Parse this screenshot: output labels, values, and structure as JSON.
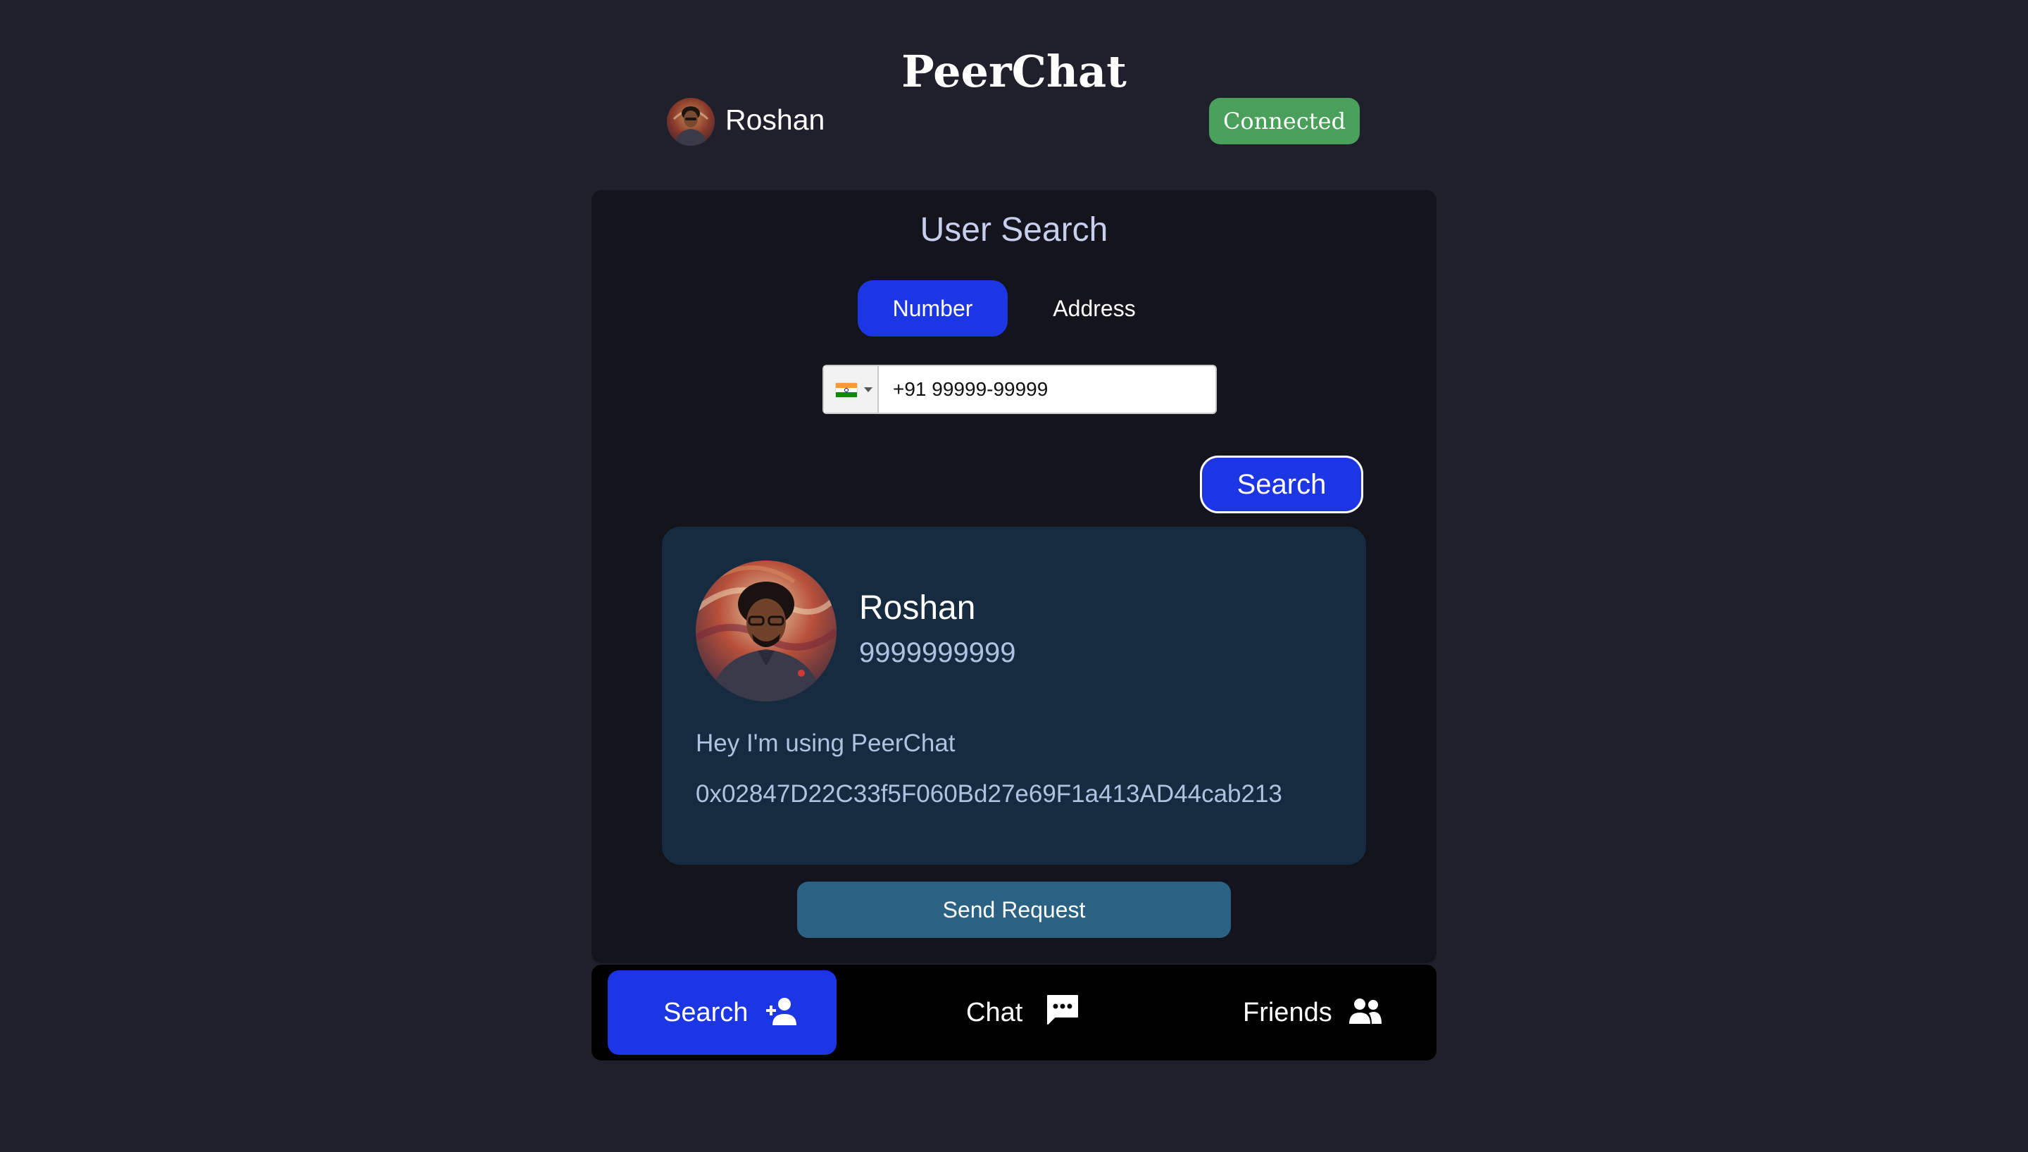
{
  "app": {
    "title": "PeerChat"
  },
  "header": {
    "user_name": "Roshan",
    "status": "Connected",
    "status_color": "#4aa05a"
  },
  "search_panel": {
    "title": "User Search",
    "tabs": [
      {
        "label": "Number",
        "active": true
      },
      {
        "label": "Address",
        "active": false
      }
    ],
    "phone_input": {
      "country": "India",
      "value": "+91 99999-99999"
    },
    "search_button": "Search",
    "accent_color": "#1d36e3"
  },
  "result": {
    "name": "Roshan",
    "number": "9999999999",
    "status": "Hey I'm using PeerChat",
    "address": "0x02847D22C33f5F060Bd27e69F1a413AD44cab213",
    "send_button": "Send Request"
  },
  "bottom_nav": {
    "items": [
      {
        "label": "Search",
        "icon": "add-user-icon",
        "active": true
      },
      {
        "label": "Chat",
        "icon": "chat-bubble-icon",
        "active": false
      },
      {
        "label": "Friends",
        "icon": "people-icon",
        "active": false
      }
    ]
  }
}
